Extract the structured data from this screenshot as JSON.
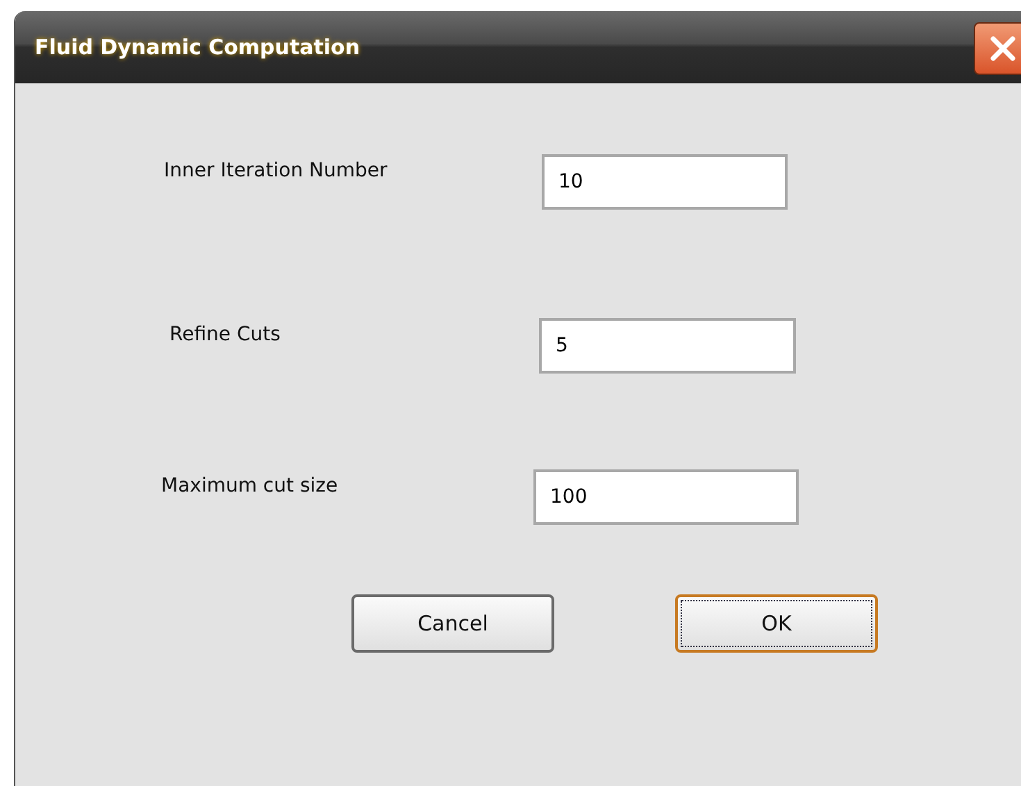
{
  "window": {
    "title": "Fluid Dynamic Computation"
  },
  "fields": [
    {
      "label": "Inner Iteration Number",
      "value": "10"
    },
    {
      "label": "Refine Cuts",
      "value": "5"
    },
    {
      "label": "Maximum cut size",
      "value": "100"
    }
  ],
  "buttons": [
    {
      "label": "Cancel",
      "default": false
    },
    {
      "label": "OK",
      "default": true
    }
  ]
}
